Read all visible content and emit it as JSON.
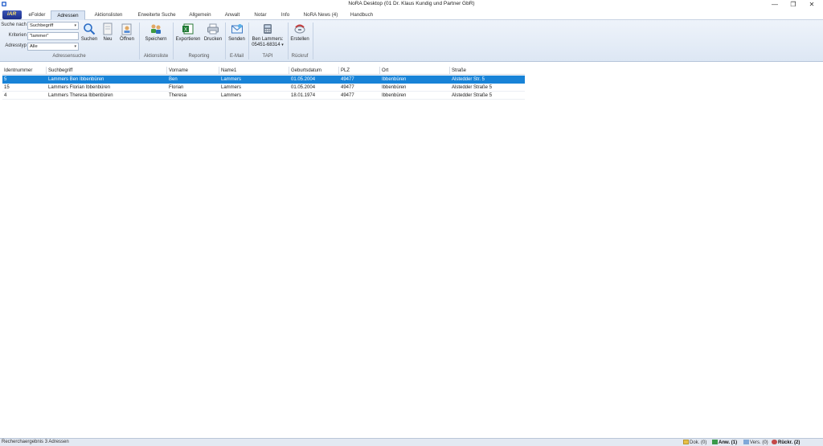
{
  "window": {
    "title": "NoRA Desktop (01 Dr. Klaus Kundig und Partner GbR)",
    "minimize": "—",
    "maximize": "❐",
    "close": "✕"
  },
  "app_button": {
    "label": "iAR"
  },
  "tabs": [
    {
      "label": "eFolder"
    },
    {
      "label": "Adressen"
    },
    {
      "label": "Aktionslisten"
    },
    {
      "label": "Erweiterte Suche"
    },
    {
      "label": "Allgemein"
    },
    {
      "label": "Anwalt"
    },
    {
      "label": "Notar"
    },
    {
      "label": "Info"
    },
    {
      "label": "NoRA News (4)"
    },
    {
      "label": "Handbuch"
    }
  ],
  "active_tab": "Adressen",
  "ribbon": {
    "search": {
      "suche_nach_label": "Suche nach",
      "suche_nach_value": "Suchbegriff",
      "kriterien_label": "Kriterien",
      "kriterien_value": "\"lammer\"",
      "adresstyp_label": "Adresstyp",
      "adresstyp_value": "Alle",
      "btn_suchen": "Suchen",
      "btn_neu": "Neu",
      "btn_oeffnen": "Öffnen",
      "group_label": "Adressensuche"
    },
    "aktionsliste": {
      "btn_speichern": "Speichern",
      "group_label": "Aktionsliste"
    },
    "reporting": {
      "btn_exportieren": "Exportieren",
      "btn_drucken": "Drucken",
      "group_label": "Reporting"
    },
    "email": {
      "btn_senden": "Senden",
      "group_label": "E-Mail"
    },
    "tapi": {
      "name": "Ben Lammers:",
      "number": "05451-68314",
      "group_label": "TAPI"
    },
    "rueckruf": {
      "btn_erstellen": "Erstellen",
      "group_label": "Rückruf"
    }
  },
  "table": {
    "columns": [
      "Identnummer",
      "Suchbegriff",
      "Vorname",
      "Name1",
      "Geburtsdatum",
      "PLZ",
      "Ort",
      "Straße"
    ],
    "rows": [
      [
        "5",
        "Lammers Ben Ibbenbüren",
        "Ben",
        "Lammers",
        "01.05.2004",
        "49477",
        "Ibbenbüren",
        "Alstedder Str. 5"
      ],
      [
        "15",
        "Lammers Florian Ibbenbüren",
        "Florian",
        "Lammers",
        "01.05.2004",
        "49477",
        "Ibbenbüren",
        "Alstedder Straße 5"
      ],
      [
        "4",
        "Lammers Theresa Ibbenbüren",
        "Theresa",
        "Lammers",
        "18.01.1974",
        "49477",
        "Ibbenbüren",
        "Alstedder Straße 5"
      ]
    ],
    "selected_row": 0
  },
  "status": {
    "text": "Recherchaergebnis 3 Adressen",
    "dok": "Dok. (0)",
    "anw": "Anw. (1)",
    "vers": "Vers. (0)",
    "rueckr": "Rückr. (2)"
  },
  "colors": {
    "accent": "#1883d7",
    "ribbon": "#dde7f4",
    "app_button": "#1d2f8a"
  }
}
